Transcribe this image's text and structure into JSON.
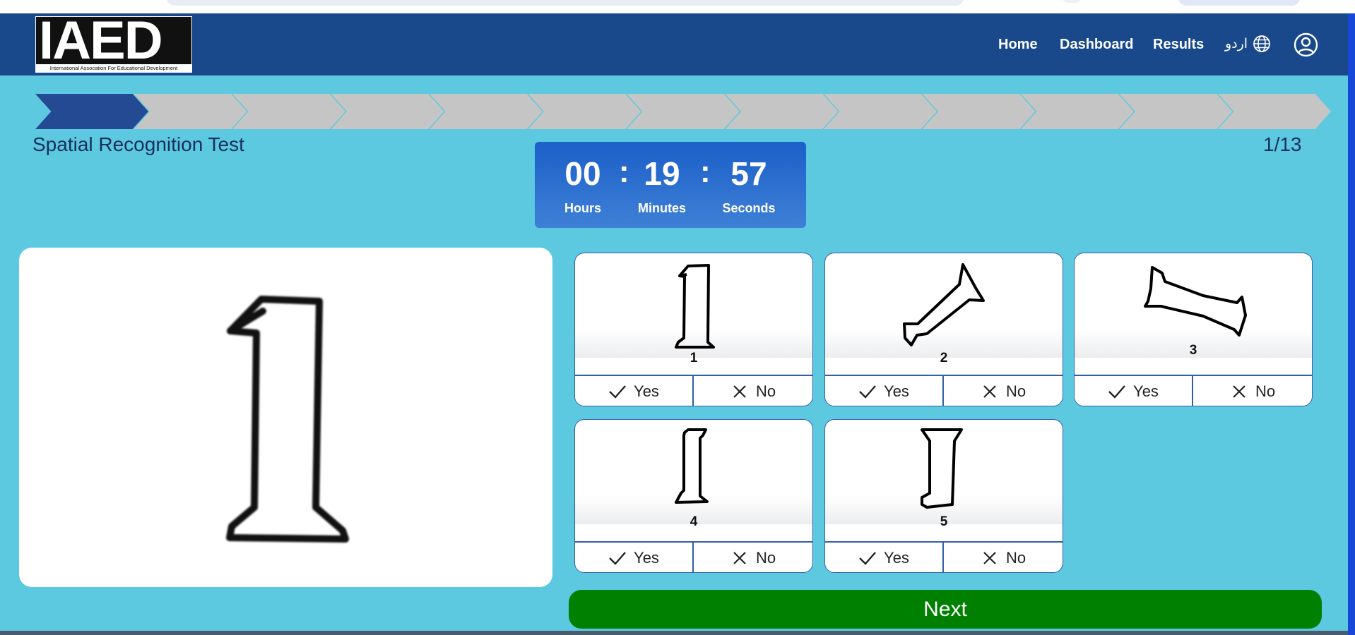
{
  "brand": {
    "logo_text": "IAED",
    "logo_tagline": "International Assocation For Educational Development"
  },
  "nav": {
    "home": "Home",
    "dashboard": "Dashboard",
    "results": "Results",
    "language": "اردو",
    "language_icon": "globe-icon",
    "profile_icon": "user-circle-icon"
  },
  "progress": {
    "total_steps": 13,
    "current_step": 1
  },
  "test": {
    "title": "Spatial Recognition Test",
    "counter": "1/13"
  },
  "timer": {
    "hours": "00",
    "minutes": "19",
    "seconds": "57",
    "separator": ":",
    "hours_label": "Hours",
    "minutes_label": "Minutes",
    "seconds_label": "Seconds"
  },
  "question": {
    "image": "digit-one-figure"
  },
  "options": [
    {
      "number": "1",
      "yes": "Yes",
      "no": "No"
    },
    {
      "number": "2",
      "yes": "Yes",
      "no": "No"
    },
    {
      "number": "3",
      "yes": "Yes",
      "no": "No"
    },
    {
      "number": "4",
      "yes": "Yes",
      "no": "No"
    },
    {
      "number": "5",
      "yes": "Yes",
      "no": "No"
    }
  ],
  "next_label": "Next",
  "colors": {
    "header": "#19498b",
    "page_bg": "#5dc9e1",
    "active_step": "#244a93",
    "inactive_step": "#c5c5c5",
    "next_button": "#008000",
    "timer": "#1b5fc8"
  }
}
